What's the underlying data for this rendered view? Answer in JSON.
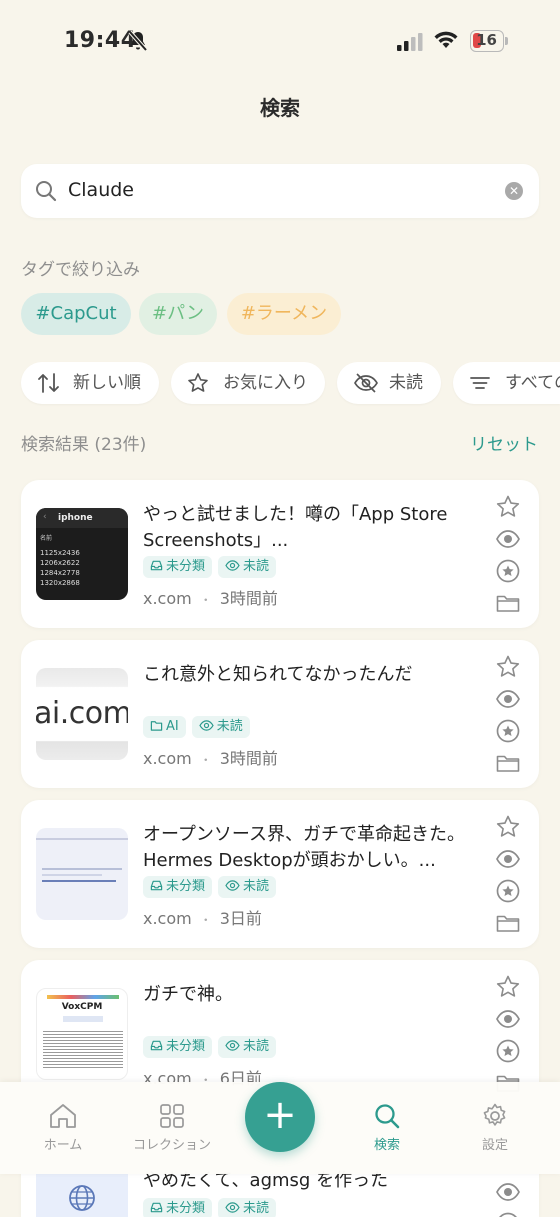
{
  "status": {
    "time": "19:44",
    "battery": "16"
  },
  "header": {
    "title": "検索"
  },
  "search": {
    "value": "Claude"
  },
  "tag_filter": {
    "label": "タグで絞り込み",
    "tags": [
      {
        "label": "#CapCut",
        "bg": "#d8ece7",
        "color": "#2c9a8d"
      },
      {
        "label": "#パン",
        "bg": "#e1f0e3",
        "color": "#6cbf83"
      },
      {
        "label": "#ラーメン",
        "bg": "#fbeed3",
        "color": "#f0b65c"
      }
    ]
  },
  "sort": {
    "newest": "新しい順",
    "favorites": "お気に入り",
    "unread": "未読",
    "all": "すべての"
  },
  "results": {
    "count_label": "検索結果 (23件)",
    "reset": "リセット"
  },
  "cards": [
    {
      "title": "やっと試せました！噂の「App Store Screenshots」...",
      "thumb_text": {
        "head": "iphone",
        "sub": "名前",
        "rows": [
          "1125x2436",
          "1206x2622",
          "1284x2778",
          "1320x2868"
        ]
      },
      "badges": [
        {
          "icon": "inbox-icon",
          "label": "未分類"
        },
        {
          "icon": "eye-icon",
          "label": "未読"
        }
      ],
      "domain": "x.com",
      "time": "3時間前"
    },
    {
      "title": "これ意外と知られてなかったんだ",
      "thumb_text": "ai.com",
      "badges": [
        {
          "icon": "folder-icon",
          "label": "AI"
        },
        {
          "icon": "eye-icon",
          "label": "未読"
        }
      ],
      "domain": "x.com",
      "time": "3時間前"
    },
    {
      "title": "オープンソース界、ガチで革命起きた。Hermes Desktopが頭おかしい。...",
      "badges": [
        {
          "icon": "inbox-icon",
          "label": "未分類"
        },
        {
          "icon": "eye-icon",
          "label": "未読"
        }
      ],
      "domain": "x.com",
      "time": "3日前"
    },
    {
      "title": "ガチで神。",
      "thumb_text": "VoxCPM",
      "badges": [
        {
          "icon": "inbox-icon",
          "label": "未分類"
        },
        {
          "icon": "eye-icon",
          "label": "未読"
        }
      ],
      "domain": "x.com",
      "time": "6日前"
    },
    {
      "title": "やめたくて、agmsg を作った",
      "badges": [
        {
          "icon": "inbox-icon",
          "label": "未分類"
        },
        {
          "icon": "eye-icon",
          "label": "未読"
        }
      ]
    }
  ],
  "tabbar": {
    "home": "ホーム",
    "collection": "コレクション",
    "add": "+",
    "search": "検索",
    "settings": "設定"
  },
  "colors": {
    "accent": "#2c9a8d",
    "background": "#f8f5eb"
  }
}
